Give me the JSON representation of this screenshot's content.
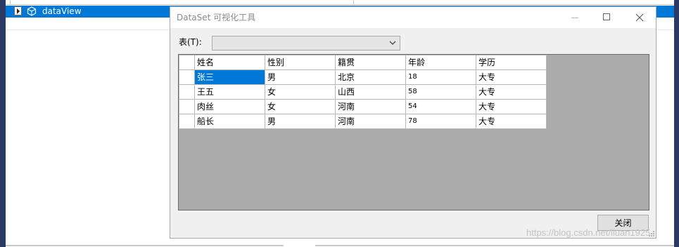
{
  "ide": {
    "watch_row": {
      "name": "dataView"
    }
  },
  "dialog": {
    "title": "DataSet 可视化工具",
    "table_label": "表(T):",
    "table_combo_value": "",
    "close_button": "关闭"
  },
  "grid": {
    "columns": [
      "姓名",
      "性别",
      "籍贯",
      "年龄",
      "学历"
    ],
    "rows": [
      [
        "张三",
        "男",
        "北京",
        "18",
        "大专"
      ],
      [
        "王五",
        "女",
        "山西",
        "58",
        "大专"
      ],
      [
        "肉丝",
        "女",
        "河南",
        "54",
        "大专"
      ],
      [
        "船长",
        "男",
        "河南",
        "78",
        "大专"
      ]
    ],
    "selected_cell": "张三"
  },
  "watermark": "https://blog.csdn.net/liuan1925",
  "colors": {
    "selection": "#0078d7",
    "grid_background": "#ababab",
    "ide_border": "#2b3a63"
  }
}
